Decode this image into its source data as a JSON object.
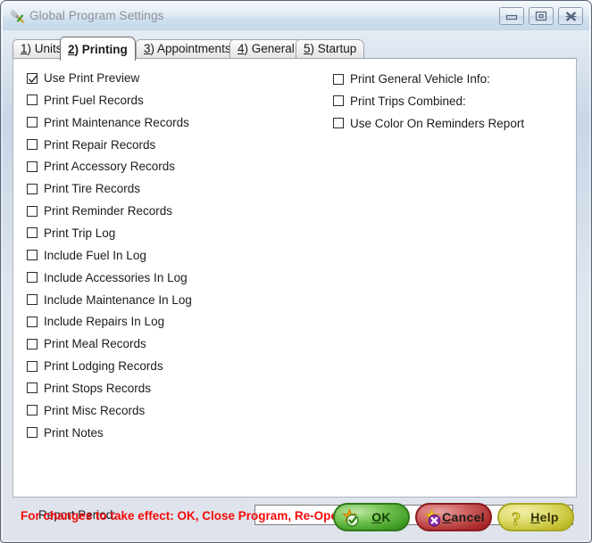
{
  "window": {
    "title": "Global Program Settings",
    "icon": "tools-icon",
    "controls": [
      {
        "name": "minimize-button",
        "icon": "minimize-icon"
      },
      {
        "name": "maximize-button",
        "icon": "maximize-icon"
      },
      {
        "name": "close-button",
        "icon": "close-icon"
      }
    ]
  },
  "tabs": [
    {
      "label": "1) Units",
      "accel": "1",
      "rest": ") Units",
      "active": false
    },
    {
      "label": "2) Printing",
      "accel": "2",
      "rest": ") Printing",
      "active": true
    },
    {
      "label": "3) Appointments",
      "accel": "3",
      "rest": ") Appointments",
      "active": false
    },
    {
      "label": "4) General",
      "accel": "4",
      "rest": ") General",
      "active": false
    },
    {
      "label": "5) Startup",
      "accel": "5",
      "rest": ") Startup",
      "active": false
    }
  ],
  "left_column": [
    {
      "label": "Use Print Preview",
      "checked": true
    },
    {
      "label": "Print Fuel Records",
      "checked": false
    },
    {
      "label": "Print Maintenance Records",
      "checked": false
    },
    {
      "label": "Print Repair Records",
      "checked": false
    },
    {
      "label": "Print Accessory Records",
      "checked": false
    },
    {
      "label": "Print Tire Records",
      "checked": false
    },
    {
      "label": "Print Reminder Records",
      "checked": false
    },
    {
      "label": "Print Trip Log",
      "checked": false
    },
    {
      "label": "Include Fuel In Log",
      "checked": false
    },
    {
      "label": "Include Accessories In Log",
      "checked": false
    },
    {
      "label": "Include Maintenance In Log",
      "checked": false
    },
    {
      "label": "Include Repairs In Log",
      "checked": false
    },
    {
      "label": "Print Meal Records",
      "checked": false
    },
    {
      "label": "Print Lodging Records",
      "checked": false
    },
    {
      "label": "Print Stops Records",
      "checked": false
    },
    {
      "label": "Print Misc Records",
      "checked": false
    },
    {
      "label": "Print Notes",
      "checked": false
    }
  ],
  "right_column": [
    {
      "label": "Print General Vehicle Info:",
      "checked": false
    },
    {
      "label": "Print Trips Combined:",
      "checked": false
    },
    {
      "label": "Use Color On Reminders Report",
      "checked": false
    }
  ],
  "report_period": {
    "label": "Report Period:",
    "value": "",
    "placeholder": ""
  },
  "footer": {
    "note": "For changes to take effect: OK, Close Program, Re-Open",
    "note_color": "#f60a0a",
    "buttons": [
      {
        "name": "ok-button",
        "accel": "O",
        "rest": "K",
        "icon": "star-check-icon",
        "color": "#3f9c25"
      },
      {
        "name": "cancel-button",
        "accel": "C",
        "rest": "ancel",
        "icon": "star-x-icon",
        "color": "#ab2b2b"
      },
      {
        "name": "help-button",
        "accel": "H",
        "rest": "elp",
        "icon": "question-mark-icon",
        "color": "#c0bd2c"
      }
    ]
  }
}
